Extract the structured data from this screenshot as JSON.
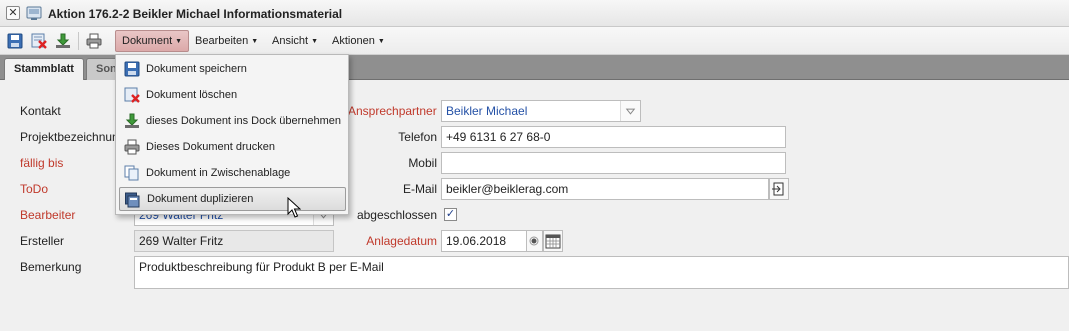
{
  "window": {
    "title": "Aktion 176.2-2 Beikler Michael Informationsmaterial",
    "close_glyph": "✕"
  },
  "toolbar": {
    "icons": [
      "save-icon",
      "delete-icon",
      "dock-download-icon",
      "print-icon"
    ],
    "menus": [
      {
        "label": "Dokument",
        "active": true
      },
      {
        "label": "Bearbeiten",
        "active": false
      },
      {
        "label": "Ansicht",
        "active": false
      },
      {
        "label": "Aktionen",
        "active": false
      }
    ]
  },
  "tabs": [
    {
      "label": "Stammblatt",
      "active": true
    },
    {
      "label": "Son",
      "active": false
    }
  ],
  "dropdown": {
    "items": [
      {
        "label": "Dokument speichern",
        "icon": "save-icon"
      },
      {
        "label": "Dokument löschen",
        "icon": "delete-icon"
      },
      {
        "label": "dieses Dokument ins Dock übernehmen",
        "icon": "dock-download-icon"
      },
      {
        "label": "Dieses Dokument drucken",
        "icon": "print-icon"
      },
      {
        "label": "Dokument in Zwischenablage",
        "icon": "copy-icon"
      },
      {
        "label": "Dokument duplizieren",
        "icon": "duplicate-icon",
        "hover": true
      }
    ]
  },
  "form": {
    "left_labels": {
      "kontakt": "Kontakt",
      "projekt": "Projektbezeichnung",
      "faellig": "fällig bis",
      "todo": "ToDo",
      "bearbeiter": "Bearbeiter",
      "ersteller": "Ersteller",
      "bemerkung": "Bemerkung"
    },
    "bearbeiter_value": "269 Walter Fritz",
    "ersteller_value": "269 Walter Fritz",
    "bemerkung_value": "Produktbeschreibung für Produkt B per E-Mail",
    "right": {
      "ansprechpartner_label": "Ansprechpartner",
      "ansprechpartner_value": "Beikler Michael",
      "telefon_label": "Telefon",
      "telefon_value": "+49 6131 6 27 68-0",
      "mobil_label": "Mobil",
      "mobil_value": "",
      "email_label": "E-Mail",
      "email_value": "beikler@beiklerag.com",
      "abgeschlossen_label": "abgeschlossen",
      "abgeschlossen_checked": true,
      "anlagedatum_label": "Anlagedatum",
      "anlagedatum_value": "19.06.2018"
    }
  },
  "colors": {
    "required_label": "#c0392b",
    "link_value": "#2451a6",
    "active_menu": "#dca9a9"
  }
}
